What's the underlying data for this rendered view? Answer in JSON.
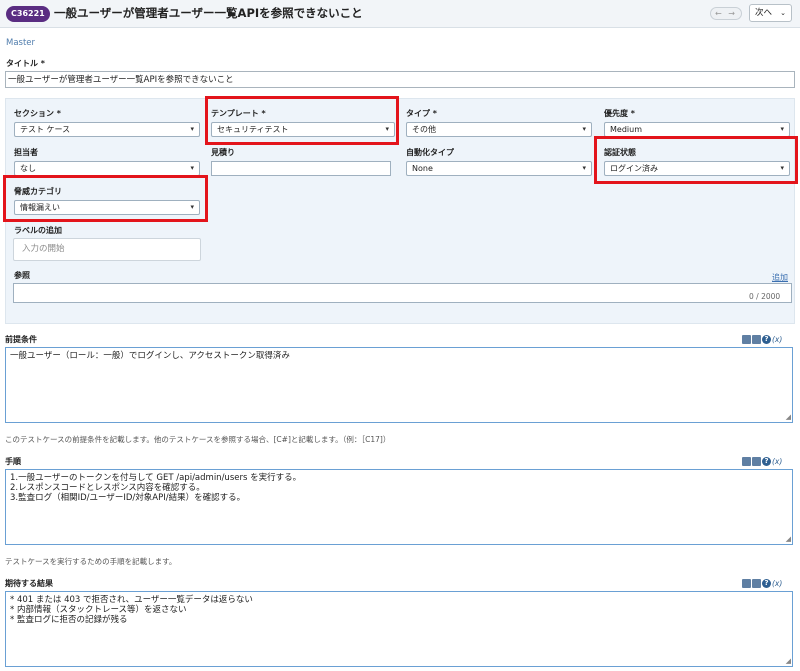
{
  "header": {
    "case_id": "C36221",
    "title": "一般ユーザーが管理者ユーザー一覧APIを参照できないこと",
    "nav_arrows": "← →",
    "next_label": "次へ",
    "next_chevron": "⌄"
  },
  "master_link": "Master",
  "title_field": {
    "label": "タイトル *",
    "value": "一般ユーザーが管理者ユーザー一覧APIを参照できないこと"
  },
  "fields": {
    "section": {
      "label": "セクション *",
      "value": "テスト ケース"
    },
    "template": {
      "label": "テンプレート *",
      "value": "セキュリティテスト"
    },
    "type": {
      "label": "タイプ *",
      "value": "その他"
    },
    "priority": {
      "label": "優先度 *",
      "value": "Medium"
    },
    "assignee": {
      "label": "担当者",
      "value": "なし"
    },
    "estimate": {
      "label": "見積り",
      "value": ""
    },
    "automation": {
      "label": "自動化タイプ",
      "value": "None"
    },
    "auth_state": {
      "label": "認証状態",
      "value": "ログイン済み"
    },
    "threat_category": {
      "label": "脅威カテゴリ",
      "value": "情報漏えい"
    },
    "labels": {
      "label": "ラベルの追加",
      "placeholder": "入力の開始"
    },
    "reference": {
      "label": "参照",
      "add_link": "追加",
      "counter": "0 / 2000"
    }
  },
  "preconditions": {
    "label": "前提条件",
    "value": "一般ユーザー（ロール：一般）でログインし、アクセストークン取得済み",
    "hint": "このテストケースの前提条件を記載します。他のテストケースを参照する場合、[C#]と記載します。（例：［C17]）"
  },
  "steps": {
    "label": "手順",
    "value": "1.一般ユーザーのトークンを付与して GET /api/admin/users を実行する。\n2.レスポンスコードとレスポンス内容を確認する。\n3.監査ログ（相関ID/ユーザーID/対象API/結果）を確認する。",
    "hint": "テストケースを実行するための手順を記載します。"
  },
  "expected": {
    "label": "期待する結果",
    "value": "* 401 または 403 で拒否され、ユーザー一覧データは返らない\n* 内部情報（スタックトレース等）を返さない\n* 監査ログに拒否の記録が残る"
  },
  "editor_tools": {
    "help": "?",
    "var": "(x)"
  },
  "icons": {
    "dropdown": "▾",
    "resize": "◢"
  },
  "colors": {
    "badge": "#5a2d82",
    "highlight": "#e3141b",
    "panel_bg": "#eef4fa",
    "link": "#3b6fb0"
  }
}
